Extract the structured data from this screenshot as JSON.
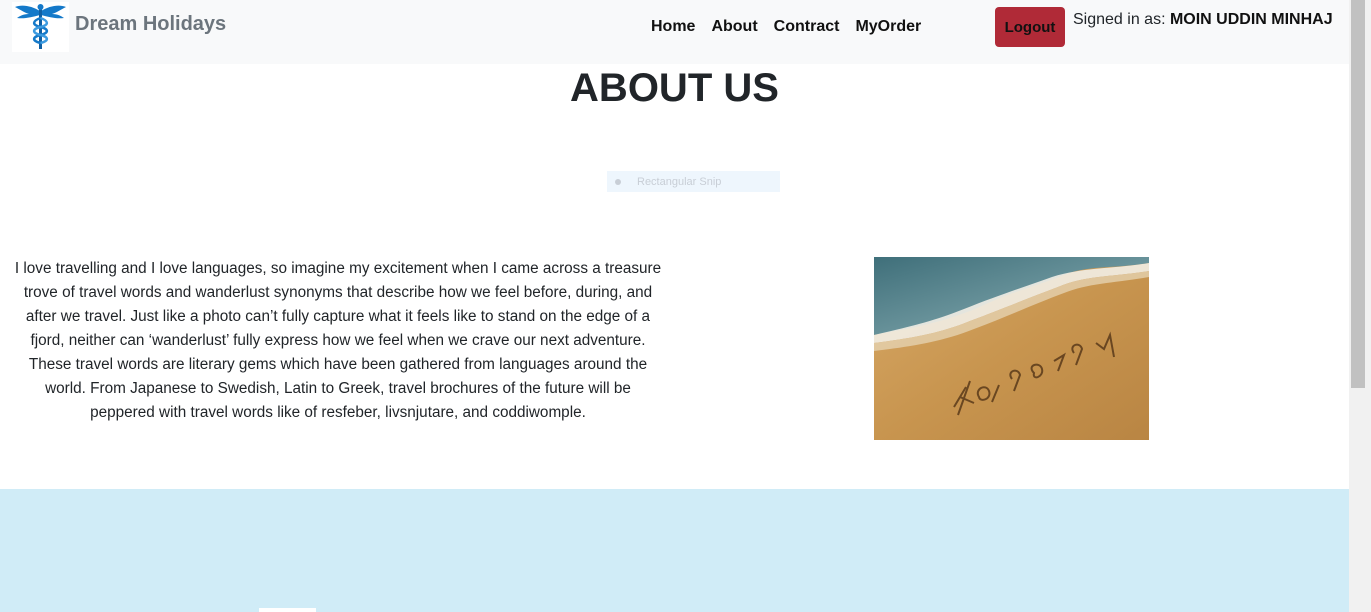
{
  "navbar": {
    "logo_icon": "caduceus-icon",
    "brand": "Dream Holidays",
    "links": [
      "Home",
      "About",
      "Contract",
      "MyOrder"
    ],
    "logout_label": "Logout",
    "signed_in_prefix": "Signed in as: ",
    "user_name": "MOIN UDDIN MINHAJ"
  },
  "main": {
    "title": "ABOUT US",
    "snip_overlay_label": "Rectangular Snip",
    "paragraph": "I love travelling and I love languages, so imagine my excitement when I came across a treasure trove of travel words and wanderlust synonyms that describe how we feel before, during, and after we travel. Just like a photo can’t fully capture what it feels like to stand on the edge of a fjord, neither can ‘wanderlust’ fully express how we feel when we crave our next adventure. These travel words are literary gems which have been gathered from languages around the world. From Japanese to Swedish, Latin to Greek, travel brochures of the future will be peppered with travel words like of resfeber, livsnjutare, and coddiwomple.",
    "image_text": "Holiday"
  },
  "colors": {
    "navbar_bg": "#f8f9fa",
    "logout_bg": "#b02a37",
    "footer_bg": "#d0ecf7",
    "brand_color": "#6c757d",
    "logo_blue": "#1479c9"
  }
}
